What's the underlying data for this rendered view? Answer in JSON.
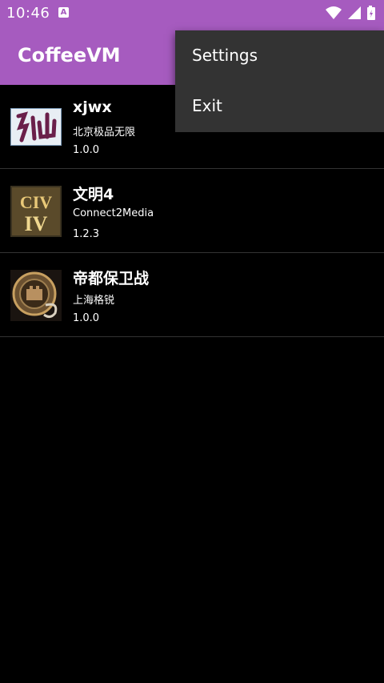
{
  "status_bar": {
    "time": "10:46",
    "notification_icon": "font-download-icon",
    "icons": [
      "wifi-icon",
      "cell-signal-icon",
      "battery-charging-icon"
    ]
  },
  "app_bar": {
    "title": "CoffeeVM",
    "color": "#a65bbf"
  },
  "apps": [
    {
      "name": "xjwx",
      "vendor": "北京极品无限",
      "version": "1.0.0",
      "icon": "xian-calligraphy-icon"
    },
    {
      "name": "文明4",
      "vendor": "Connect2Media",
      "version": "1.2.3",
      "icon": "civ-iv-icon"
    },
    {
      "name": "帝都保卫战",
      "vendor": "上海格锐",
      "version": "1.0.0",
      "icon": "castle-emblem-icon"
    }
  ],
  "overflow_menu": {
    "items": [
      "Settings",
      "Exit"
    ],
    "background": "#333333"
  }
}
